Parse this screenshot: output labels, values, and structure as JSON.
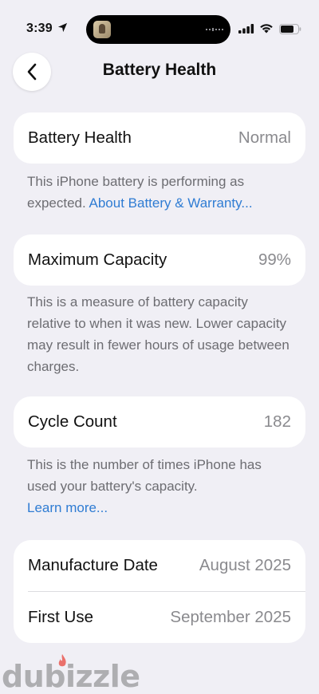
{
  "status_bar": {
    "time": "3:39"
  },
  "nav": {
    "title": "Battery Health"
  },
  "sections": {
    "health": {
      "label": "Battery Health",
      "value": "Normal",
      "footnote_text": "This iPhone battery is performing as expected. ",
      "footnote_link": "About Battery & Warranty..."
    },
    "capacity": {
      "label": "Maximum Capacity",
      "value": "99%",
      "footnote_text": "This is a measure of battery capacity relative to when it was new. Lower capacity may result in fewer hours of usage between charges."
    },
    "cycles": {
      "label": "Cycle Count",
      "value": "182",
      "footnote_text": "This is the number of times iPhone has used your battery's capacity.",
      "footnote_link": "Learn more..."
    },
    "dates": {
      "manufacture_label": "Manufacture Date",
      "manufacture_value": "August 2025",
      "first_use_label": "First Use",
      "first_use_value": "September 2025"
    }
  },
  "watermark": {
    "text": "dubizzle"
  },
  "colors": {
    "background": "#f0eff5",
    "card": "#ffffff",
    "link": "#2f7cd3",
    "secondary_text": "#8a8a8e",
    "footnote_text": "#6d6d72",
    "watermark_flame": "#e8453c"
  },
  "icons": [
    "location-arrow-icon",
    "cellular-signal-icon",
    "wifi-icon",
    "battery-icon",
    "chevron-left-icon"
  ]
}
